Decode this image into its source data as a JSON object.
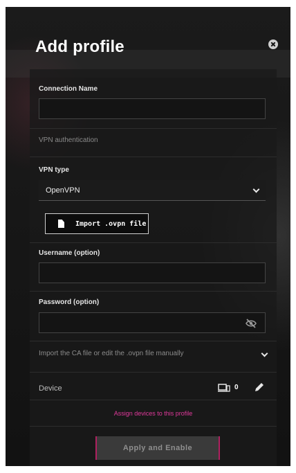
{
  "dialog": {
    "title": "Add profile",
    "close_icon": "close-circle-icon"
  },
  "form": {
    "connection_name": {
      "label": "Connection Name",
      "value": ""
    },
    "vpn_authentication": {
      "label": "VPN authentication"
    },
    "vpn_type": {
      "label": "VPN type",
      "selected": "OpenVPN"
    },
    "import_button": {
      "label": "Import .ovpn file",
      "icon": "file-icon"
    },
    "username": {
      "label": "Username (option)",
      "value": ""
    },
    "password": {
      "label": "Password (option)",
      "value": "",
      "icon": "eye-slash-icon"
    },
    "ca_file": {
      "label": "Import the CA file or edit the .ovpn file manually"
    },
    "device": {
      "label": "Device",
      "count": "0",
      "icon": "devices-icon",
      "edit_icon": "pencil-icon"
    },
    "assign_link": "Assign devices to this profile",
    "apply_button": "Apply and Enable"
  },
  "colors": {
    "accent": "#e0399b",
    "background": "#151515"
  }
}
